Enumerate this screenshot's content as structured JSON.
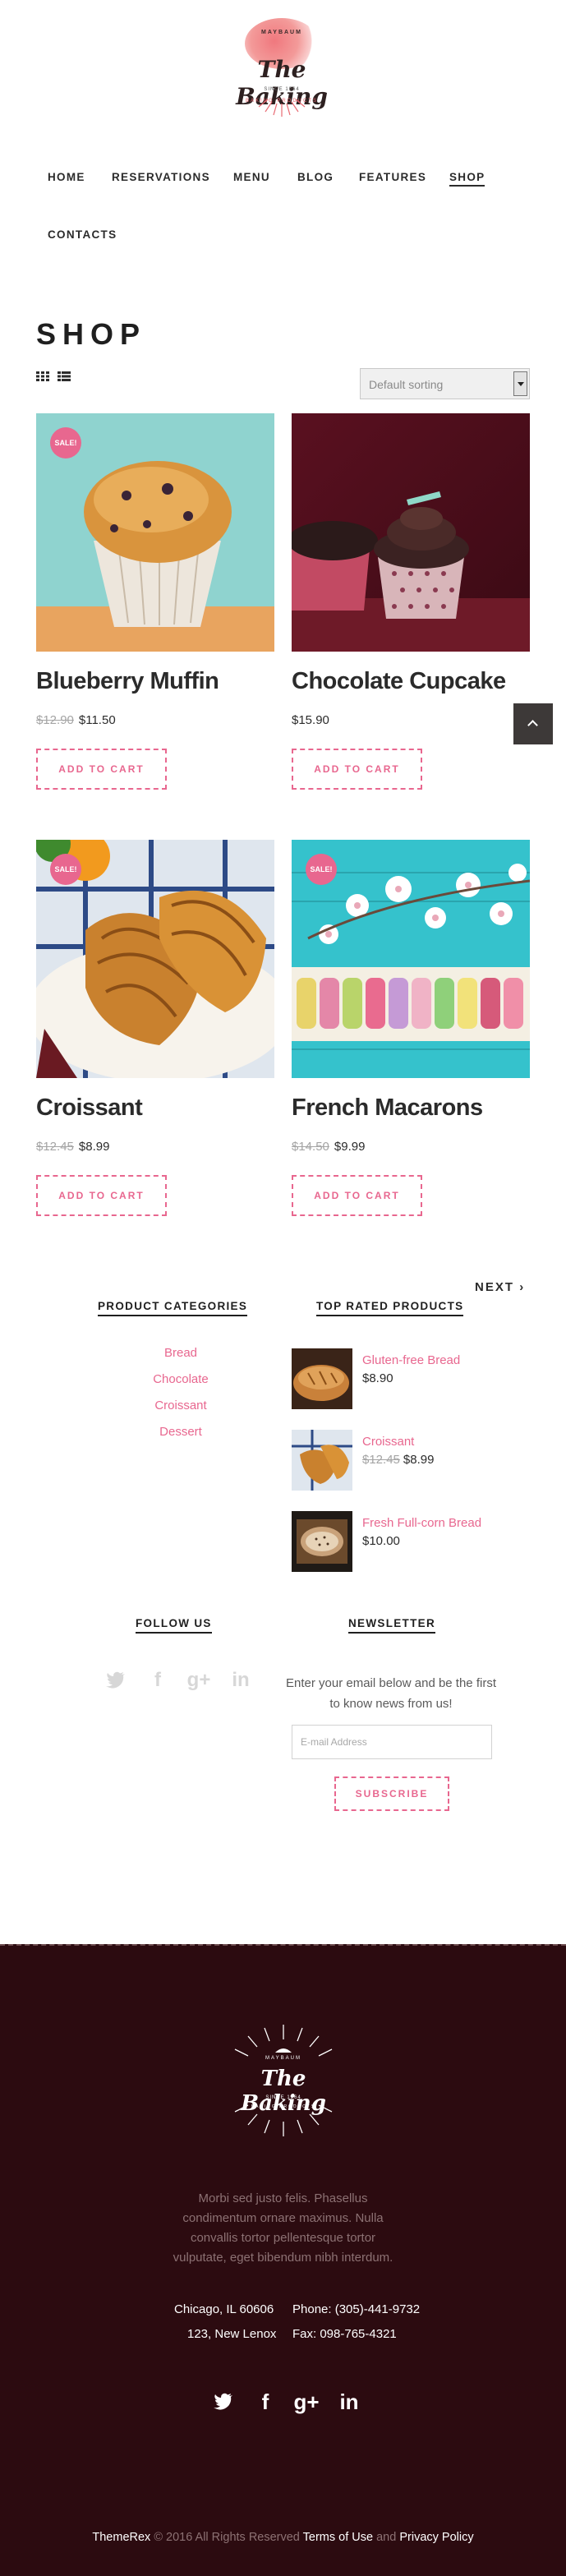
{
  "header": {
    "logo": {
      "brand": "The Baking",
      "tagline_top": "MAYBAUM",
      "since": "SINCE 1964",
      "tagline_bottom": "BAKING PRODUCTS"
    },
    "nav": [
      {
        "label": "HOME"
      },
      {
        "label": "RESERVATIONS"
      },
      {
        "label": "MENU"
      },
      {
        "label": "BLOG"
      },
      {
        "label": "FEATURES"
      },
      {
        "label": "SHOP",
        "active": true
      },
      {
        "label": "CONTACTS"
      }
    ]
  },
  "shop": {
    "title": "SHOP",
    "view_icons": [
      "grid-view-icon",
      "list-view-icon"
    ],
    "sorting": {
      "selected": "Default sorting"
    },
    "sale_badge": "SALE!",
    "add_to_cart_label": "ADD TO CART",
    "products": [
      {
        "name": "Blueberry Muffin",
        "old_price": "$12.90",
        "price": "$11.50",
        "sale": true
      },
      {
        "name": "Chocolate Cupcake",
        "old_price": "",
        "price": "$15.90",
        "sale": false
      },
      {
        "name": "Croissant",
        "old_price": "$12.45",
        "price": "$8.99",
        "sale": true
      },
      {
        "name": "French Macarons",
        "old_price": "$14.50",
        "price": "$9.99",
        "sale": true
      }
    ],
    "next_label": "NEXT"
  },
  "widgets": {
    "categories": {
      "title": "PRODUCT CATEGORIES",
      "items": [
        "Bread",
        "Chocolate",
        "Croissant",
        "Dessert"
      ]
    },
    "top_rated": {
      "title": "TOP RATED PRODUCTS",
      "items": [
        {
          "name": "Gluten-free Bread",
          "old_price": "",
          "price": "$8.90"
        },
        {
          "name": "Croissant",
          "old_price": "$12.45",
          "price": "$8.99"
        },
        {
          "name": "Fresh Full-corn Bread",
          "old_price": "",
          "price": "$10.00"
        }
      ]
    },
    "follow": {
      "title": "FOLLOW US",
      "icons": [
        "twitter-icon",
        "facebook-icon",
        "google-plus-icon",
        "linkedin-icon"
      ]
    },
    "newsletter": {
      "title": "NEWSLETTER",
      "text": "Enter your email below and be the first to know news from us!",
      "placeholder": "E-mail Address",
      "button": "SUBSCRIBE"
    }
  },
  "footer": {
    "logo": {
      "brand": "The Baking",
      "tagline_top": "MAYBAUM",
      "since": "SINCE 1964",
      "tagline_bottom": "BAKING PRODUCTS"
    },
    "about": "Morbi sed justo felis. Phasellus condimentum ornare maximus. Nulla convallis tortor pellentesque tortor vulputate, eget bibendum nibh interdum.",
    "address_line1": "Chicago, IL 60606",
    "address_line2": "123, New Lenox",
    "phone": "Phone: (305)-441-9732",
    "fax": "Fax: 098-765-4321",
    "social_icons": [
      "twitter-icon",
      "facebook-icon",
      "google-plus-icon",
      "linkedin-icon"
    ],
    "copyright": {
      "brand": "ThemeRex",
      "text": "© 2016 All Rights Reserved",
      "terms": "Terms of Use",
      "and": "and",
      "privacy": "Privacy Policy"
    }
  },
  "colors": {
    "accent": "#e8678f",
    "footer_bg": "#2c0b10",
    "text_dark": "#2b2b2b"
  }
}
